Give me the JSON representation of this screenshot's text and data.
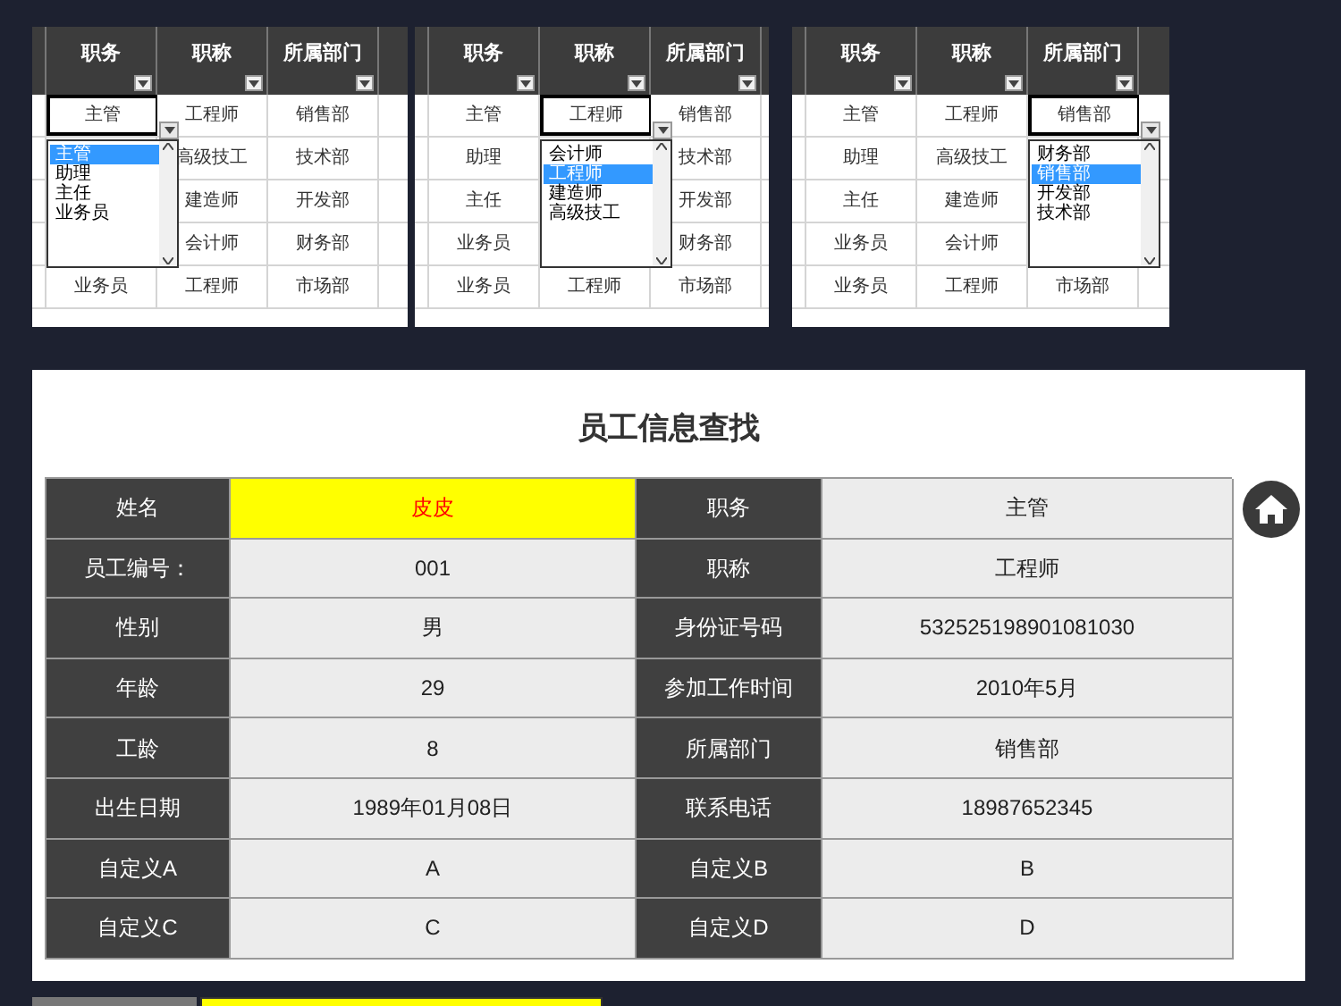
{
  "mini_tables": [
    {
      "columns": [
        "职务",
        "职称",
        "所属部门"
      ],
      "rows": [
        [
          "主管",
          "工程师",
          "销售部"
        ],
        [
          null,
          "高级技工",
          "技术部"
        ],
        [
          null,
          "建造师",
          "开发部"
        ],
        [
          null,
          "会计师",
          "财务部"
        ],
        [
          "业务员",
          "工程师",
          "市场部"
        ]
      ],
      "dropdown": [
        {
          "label": "主管",
          "selected": true
        },
        {
          "label": "助理",
          "selected": false
        },
        {
          "label": "主任",
          "selected": false
        },
        {
          "label": "业务员",
          "selected": false
        }
      ]
    },
    {
      "columns": [
        "职务",
        "职称",
        "所属部门"
      ],
      "rows": [
        [
          "主管",
          "工程师",
          "销售部"
        ],
        [
          "助理",
          null,
          "技术部"
        ],
        [
          "主任",
          null,
          "开发部"
        ],
        [
          "业务员",
          null,
          "财务部"
        ],
        [
          "业务员",
          "工程师",
          "市场部"
        ]
      ],
      "dropdown": [
        {
          "label": "会计师",
          "selected": false
        },
        {
          "label": "工程师",
          "selected": true
        },
        {
          "label": "建造师",
          "selected": false
        },
        {
          "label": "高级技工",
          "selected": false
        }
      ]
    },
    {
      "columns": [
        "职务",
        "职称",
        "所属部门"
      ],
      "rows": [
        [
          "主管",
          "工程师",
          "销售部"
        ],
        [
          "助理",
          "高级技工",
          null
        ],
        [
          "主任",
          "建造师",
          null
        ],
        [
          "业务员",
          "会计师",
          null
        ],
        [
          "业务员",
          "工程师",
          "市场部"
        ]
      ],
      "dropdown": [
        {
          "label": "财务部",
          "selected": false
        },
        {
          "label": "销售部",
          "selected": true
        },
        {
          "label": "开发部",
          "selected": false
        },
        {
          "label": "技术部",
          "selected": false
        }
      ]
    }
  ],
  "form": {
    "title": "员工信息查找",
    "rows": [
      {
        "label_1": "姓名",
        "value_1": "皮皮",
        "highlighted": true,
        "label_2": "职务",
        "value_2": "主管"
      },
      {
        "label_1": "员工编号：",
        "value_1": "001",
        "highlighted": false,
        "label_2": "职称",
        "value_2": "工程师"
      },
      {
        "label_1": "性别",
        "value_1": "男",
        "highlighted": false,
        "label_2": "身份证号码",
        "value_2": "532525198901081030"
      },
      {
        "label_1": "年龄",
        "value_1": "29",
        "highlighted": false,
        "label_2": "参加工作时间",
        "value_2": "2010年5月"
      },
      {
        "label_1": "工龄",
        "value_1": "8",
        "highlighted": false,
        "label_2": "所属部门",
        "value_2": "销售部"
      },
      {
        "label_1": "出生日期",
        "value_1": "1989年01月08日",
        "highlighted": false,
        "label_2": "联系电话",
        "value_2": "18987652345"
      },
      {
        "label_1": "自定义A",
        "value_1": "A",
        "highlighted": false,
        "label_2": "自定义B",
        "value_2": "B"
      },
      {
        "label_1": "自定义C",
        "value_1": "C",
        "highlighted": false,
        "label_2": "自定义D",
        "value_2": "D"
      }
    ]
  }
}
